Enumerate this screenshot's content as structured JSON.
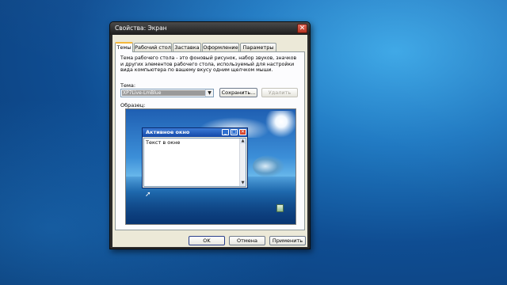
{
  "dialog": {
    "title": "Свойства: Экран",
    "close_glyph": "✕"
  },
  "tabs": [
    "Темы",
    "Рабочий стол",
    "Заставка",
    "Оформление",
    "Параметры"
  ],
  "themes_panel": {
    "description": "Тема рабочего стола - это фоновый рисунок, набор звуков, значков и других элементов рабочего стола, используемый для настройки вида компьютера по вашему вкусу одним щелчком мыши.",
    "theme_label": "Тема:",
    "theme_value": "XP7Live-LmBlue",
    "save_button": "Сохранить...",
    "delete_button": "Удалить",
    "preview_label": "Образец:",
    "preview_window": {
      "title": "Активное окно",
      "body_text": "Текст в окне"
    }
  },
  "buttons": {
    "ok": "OK",
    "cancel": "Отмена",
    "apply": "Применить"
  },
  "colors": {
    "titlebar": "#2b2b2b",
    "active_tab_accent": "#f4b73b",
    "preview_title": "#1247a8"
  },
  "icons": {
    "combo_arrow": "▼",
    "min": "_",
    "max": "□",
    "close": "✕",
    "scroll_up": "▲",
    "scroll_down": "▼",
    "cursor": "➚"
  }
}
